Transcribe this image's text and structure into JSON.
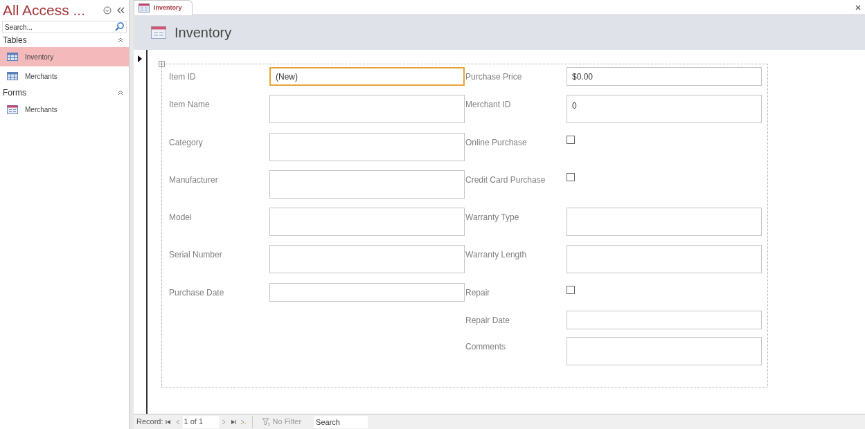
{
  "navigation_pane": {
    "title": "All Access ...",
    "search": {
      "placeholder": "Search..."
    },
    "groups": [
      {
        "label": "Tables",
        "expanded": true,
        "items": [
          {
            "label": "Inventory",
            "kind": "table",
            "selected": true
          },
          {
            "label": "Merchants",
            "kind": "table",
            "selected": false
          }
        ]
      },
      {
        "label": "Forms",
        "expanded": true,
        "items": [
          {
            "label": "Merchants",
            "kind": "form",
            "selected": false
          }
        ]
      }
    ]
  },
  "document_tabs": [
    {
      "label": "Inventory",
      "selected": true
    }
  ],
  "form": {
    "title": "Inventory",
    "left_fields": [
      {
        "label": "Item ID",
        "kind": "text",
        "value": "(New)",
        "focused": true
      },
      {
        "label": "Item Name",
        "kind": "memo",
        "focused": false
      },
      {
        "label": "Category",
        "kind": "memo",
        "focused": false
      },
      {
        "label": "Manufacturer",
        "kind": "memo",
        "focused": false
      },
      {
        "label": "Model",
        "kind": "memo",
        "focused": false
      },
      {
        "label": "Serial Number",
        "kind": "memo",
        "focused": false
      },
      {
        "label": "Purchase Date",
        "kind": "text",
        "focused": false
      }
    ],
    "right_fields": [
      {
        "label": "Purchase Price",
        "kind": "text",
        "value": "$0.00",
        "focused": false
      },
      {
        "label": "Merchant ID",
        "kind": "memo",
        "value": "0",
        "focused": false
      },
      {
        "label": "Online Purchase",
        "kind": "checkbox",
        "checked": false
      },
      {
        "label": "Credit Card Purchase",
        "kind": "checkbox",
        "checked": false
      },
      {
        "label": "Warranty Type",
        "kind": "memo",
        "focused": false
      },
      {
        "label": "Warranty Length",
        "kind": "memo",
        "focused": false
      },
      {
        "label": "Repair",
        "kind": "checkbox",
        "checked": false
      },
      {
        "label": "Repair Date",
        "kind": "text",
        "focused": false
      },
      {
        "label": "Comments",
        "kind": "memo",
        "focused": false
      }
    ]
  },
  "record_navigator": {
    "label": "Record:",
    "position": "1 of 1",
    "filter": "No Filter",
    "search": {
      "placeholder": "Search"
    }
  }
}
